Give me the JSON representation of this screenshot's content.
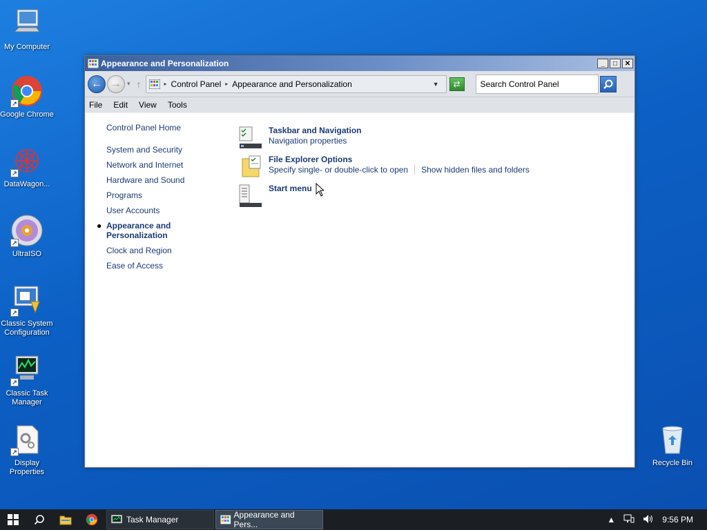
{
  "desktop": {
    "icons": [
      {
        "label": "My Computer"
      },
      {
        "label": "Google Chrome"
      },
      {
        "label": "DataWagon..."
      },
      {
        "label": "UltraISO"
      },
      {
        "label": "Classic System Configuration"
      },
      {
        "label": "Classic Task Manager"
      },
      {
        "label": "Display Properties"
      },
      {
        "label": "Recycle Bin"
      }
    ]
  },
  "window": {
    "title": "Appearance and Personalization",
    "buttons": {
      "minimize": "_",
      "maximize": "□",
      "close": "✕"
    },
    "address": {
      "crumb1": "Control Panel",
      "crumb2": "Appearance and Personalization"
    },
    "search": {
      "placeholder": "Search Control Panel"
    },
    "menu": {
      "file": "File",
      "edit": "Edit",
      "view": "View",
      "tools": "Tools"
    },
    "sidebar": {
      "home": "Control Panel Home",
      "items": [
        "System and Security",
        "Network and Internet",
        "Hardware and Sound",
        "Programs",
        "User Accounts",
        "Appearance and Personalization",
        "Clock and Region",
        "Ease of Access"
      ]
    },
    "main": {
      "entries": [
        {
          "title": "Taskbar and Navigation",
          "links": [
            "Navigation properties"
          ]
        },
        {
          "title": "File Explorer Options",
          "links": [
            "Specify single- or double-click to open",
            "Show hidden files and folders"
          ]
        },
        {
          "title": "Start menu",
          "links": []
        }
      ]
    }
  },
  "taskbar": {
    "tasks": [
      {
        "label": "Task Manager"
      },
      {
        "label": "Appearance and Pers..."
      }
    ],
    "clock": "9:56 PM"
  },
  "colors": {
    "link": "#1b3a73",
    "titlebar": "#3a5f9c",
    "desktop": "#0c5fc4"
  }
}
